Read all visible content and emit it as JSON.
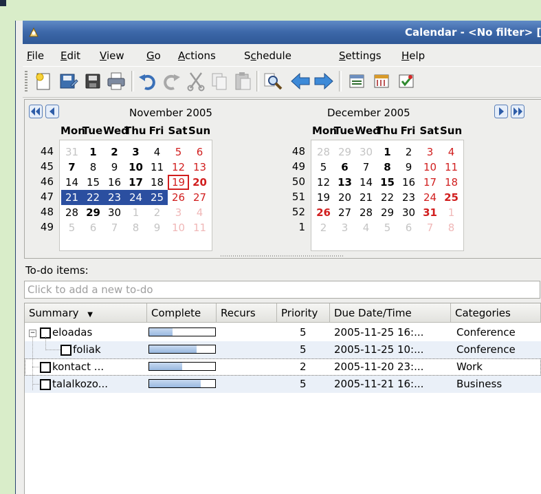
{
  "window": {
    "title": "Calendar - <No filter>  [n"
  },
  "menu": {
    "file": {
      "pre": "",
      "key": "F",
      "post": "ile"
    },
    "edit": {
      "pre": "",
      "key": "E",
      "post": "dit"
    },
    "view": {
      "pre": "",
      "key": "V",
      "post": "iew"
    },
    "go": {
      "pre": "",
      "key": "G",
      "post": "o"
    },
    "actions": {
      "pre": "",
      "key": "A",
      "post": "ctions"
    },
    "schedule": {
      "pre": "S",
      "key": "c",
      "post": "hedule"
    },
    "settings": {
      "pre": "",
      "key": "S",
      "post": "ettings"
    },
    "help": {
      "pre": "",
      "key": "H",
      "post": "elp"
    }
  },
  "toolbar": {
    "icons": [
      "new-icon",
      "save-icon",
      "floppy-icon",
      "print-icon",
      "undo-icon",
      "redo-icon",
      "cut-icon",
      "copy-icon",
      "paste-icon",
      "search-icon",
      "back-arrow-icon",
      "forward-arrow-icon",
      "day-view-icon",
      "week-view-icon",
      "todo-icon"
    ]
  },
  "calendar": {
    "days_of_week": [
      "Mon",
      "Tue",
      "Wed",
      "Thu",
      "Fri",
      "Sat",
      "Sun"
    ],
    "months": [
      {
        "title": "November 2005",
        "weeks": [
          "44",
          "45",
          "46",
          "47",
          "48",
          "49"
        ],
        "days": [
          [
            "31",
            "1",
            "2",
            "3",
            "4",
            "5",
            "6"
          ],
          [
            "7",
            "8",
            "9",
            "10",
            "11",
            "12",
            "13"
          ],
          [
            "14",
            "15",
            "16",
            "17",
            "18",
            "19",
            "20"
          ],
          [
            "21",
            "22",
            "23",
            "24",
            "25",
            "26",
            "27"
          ],
          [
            "28",
            "29",
            "30",
            "1",
            "2",
            "3",
            "4"
          ],
          [
            "5",
            "6",
            "7",
            "8",
            "9",
            "10",
            "11"
          ]
        ]
      },
      {
        "title": "December 2005",
        "weeks": [
          "48",
          "49",
          "50",
          "51",
          "52",
          "1"
        ],
        "days": [
          [
            "28",
            "29",
            "30",
            "1",
            "2",
            "3",
            "4"
          ],
          [
            "5",
            "6",
            "7",
            "8",
            "9",
            "10",
            "11"
          ],
          [
            "12",
            "13",
            "14",
            "15",
            "16",
            "17",
            "18"
          ],
          [
            "19",
            "20",
            "21",
            "22",
            "23",
            "24",
            "25"
          ],
          [
            "26",
            "27",
            "28",
            "29",
            "30",
            "31",
            "1"
          ],
          [
            "2",
            "3",
            "4",
            "5",
            "6",
            "7",
            "8"
          ]
        ]
      }
    ],
    "colors": {
      "selection": "#2b4fa0",
      "weekend": "#d11e1e",
      "today_border": "#d11e1e"
    }
  },
  "todo": {
    "label": "To-do items:",
    "placeholder": "Click to add a new to-do",
    "columns": [
      "Summary",
      "Complete",
      "Recurs",
      "Priority",
      "Due Date/Time",
      "Categories"
    ],
    "items": [
      {
        "summary": "eloadas",
        "complete": 0.35,
        "recurs": "",
        "priority": "5",
        "due": "2005-11-25 16:...",
        "category": "Conference"
      },
      {
        "summary": "foliak",
        "complete": 0.72,
        "recurs": "",
        "priority": "5",
        "due": "2005-11-25 10:...",
        "category": "Conference"
      },
      {
        "summary": "kontact ...",
        "complete": 0.5,
        "recurs": "",
        "priority": "2",
        "due": "2005-11-20 23:...",
        "category": "Work"
      },
      {
        "summary": "talalkozo...",
        "complete": 0.78,
        "recurs": "",
        "priority": "5",
        "due": "2005-11-21 16:...",
        "category": "Business"
      }
    ]
  }
}
